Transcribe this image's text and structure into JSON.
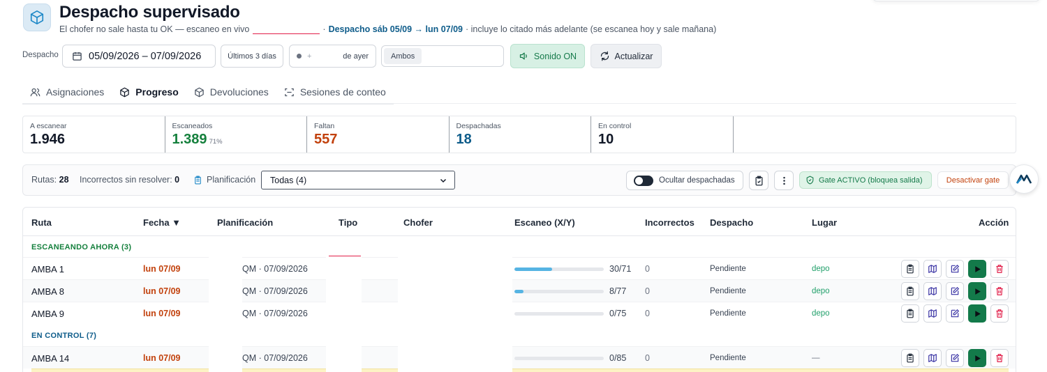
{
  "header": {
    "title": "Despacho supervisado",
    "subtitle_prefix": "El chofer no sale hasta tu OK — escaneo en vivo",
    "subtitle_sep": "·",
    "subtitle_range": "Despacho sáb 05/09 → lun 07/09",
    "subtitle_suffix": "· incluye lo citado más adelante (se escanea hoy y sale mañana)"
  },
  "toolbar": {
    "despacho_label": "Despacho",
    "date_range": "05/09/2026 – 07/09/2026",
    "last3_label": "Últimos 3 días",
    "plus": "+",
    "yesterday_label": "de ayer",
    "both_label": "Ambos",
    "sound_label": "Sonido ON",
    "refresh_label": "Actualizar"
  },
  "tabs": [
    {
      "label": "Asignaciones",
      "icon": "users-icon",
      "active": false
    },
    {
      "label": "Progreso",
      "icon": "box-icon",
      "active": true
    },
    {
      "label": "Devoluciones",
      "icon": "box-icon",
      "active": false
    },
    {
      "label": "Sesiones de conteo",
      "icon": "scan-icon",
      "active": false
    }
  ],
  "stats": [
    {
      "label": "A escanear",
      "value": "1.946",
      "pct": ""
    },
    {
      "label": "Escaneados",
      "value": "1.389",
      "pct": "71%"
    },
    {
      "label": "Faltan",
      "value": "557",
      "pct": ""
    },
    {
      "label": "Despachadas",
      "value": "18",
      "pct": ""
    },
    {
      "label": "En control",
      "value": "10",
      "pct": ""
    }
  ],
  "filterbar": {
    "routes_label": "Rutas:",
    "routes_value": "28",
    "incorrect_label": "Incorrectos sin resolver:",
    "incorrect_value": "0",
    "plan_label": "Planificación",
    "plan_select": "Todas (4)",
    "hide_dispatched_label": "Ocultar despachadas",
    "gate_label": "Gate ACTIVO (bloquea salida)",
    "deactivate_label": "Desactivar gate"
  },
  "table": {
    "columns": [
      "Ruta",
      "Fecha ▼",
      "Planificación",
      "Tipo",
      "Chofer",
      "Escaneo (X/Y)",
      "Incorrectos",
      "Despacho",
      "Lugar",
      "Acción"
    ],
    "groups": [
      {
        "label": "ESCANEANDO AHORA (3)"
      },
      {
        "label": "EN CONTROL (7)"
      }
    ],
    "rows": [
      {
        "route": "AMBA 1",
        "date": "lun 07/09",
        "plan": "QM · 07/09/2026",
        "scan": "30/71",
        "progress": 0.42,
        "incorrect": "0",
        "dispatch": "Pendiente",
        "place": "depo"
      },
      {
        "route": "AMBA 8",
        "date": "lun 07/09",
        "plan": "QM · 07/09/2026",
        "scan": "8/77",
        "progress": 0.1,
        "incorrect": "0",
        "dispatch": "Pendiente",
        "place": "depo"
      },
      {
        "route": "AMBA 9",
        "date": "lun 07/09",
        "plan": "QM · 07/09/2026",
        "scan": "0/75",
        "progress": 0,
        "incorrect": "0",
        "dispatch": "Pendiente",
        "place": "depo"
      },
      {
        "route": "AMBA 14",
        "date": "lun 07/09",
        "plan": "QM · 07/09/2026",
        "scan": "0/85",
        "progress": 0,
        "incorrect": "0",
        "dispatch": "Pendiente",
        "place": "—"
      }
    ]
  },
  "colors": {
    "accent": "#0e5c8a",
    "green": "#15803d",
    "orange": "#c2410c",
    "play": "#137a4a"
  },
  "logo_text": "M"
}
